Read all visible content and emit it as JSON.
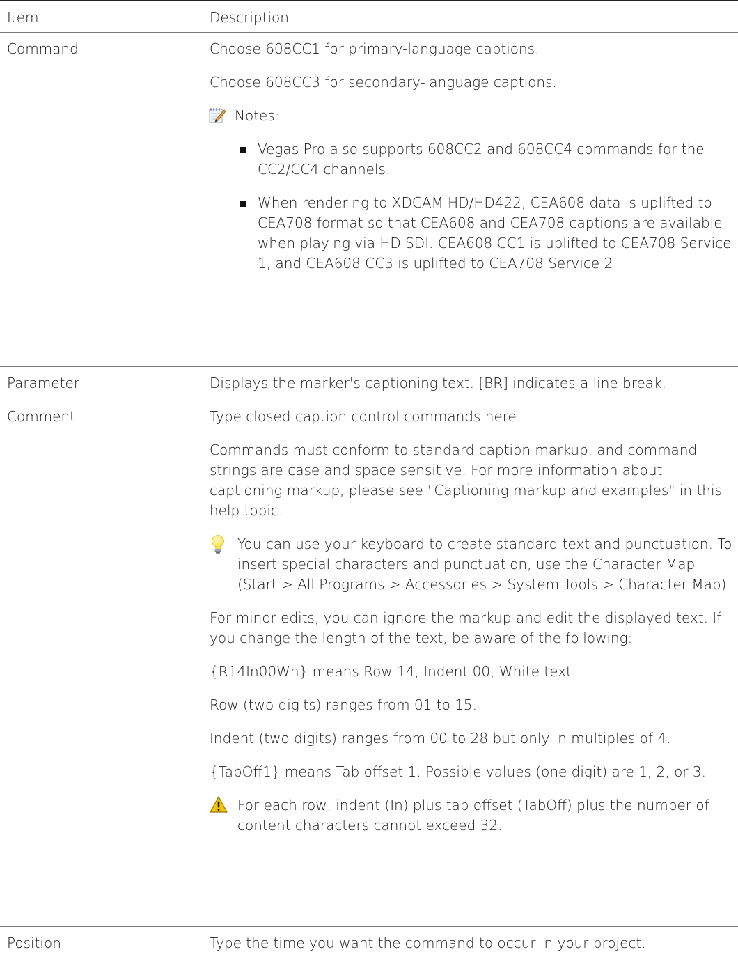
{
  "header": {
    "item": "Item",
    "description": "Description"
  },
  "rows": {
    "command": {
      "item": "Command",
      "p1": "Choose 608CC1 for primary-language captions.",
      "p2": "Choose 608CC3 for secondary-language captions.",
      "notes_label": "Notes:",
      "bullet1": "Vegas Pro also supports 608CC2 and 608CC4 commands for the CC2/CC4 channels.",
      "bullet2": "When rendering to XDCAM HD/HD422, CEA608 data is uplifted to CEA708 format so that CEA608 and CEA708 captions are available when playing via HD SDI. CEA608 CC1 is uplifted to CEA708 Service 1, and CEA608 CC3 is uplifted to CEA708 Service 2."
    },
    "parameter": {
      "item": "Parameter",
      "desc": "Displays the marker's captioning text. [BR] indicates a line break."
    },
    "comment": {
      "item": "Comment",
      "p1": "Type closed caption control commands here.",
      "p2": "Commands must conform to standard caption markup, and command strings are case and space sensitive. For more information about captioning markup, please see \"Captioning markup and examples\" in this help topic.",
      "tip": "You can use your keyboard to create standard text and punctuation. To insert special characters and punctuation, use the Character Map (Start > All Programs > Accessories > System Tools > Character Map)",
      "p3": "For minor edits, you can ignore the markup and edit the displayed text. If you change the length of the text, be aware of the following:",
      "p4": "{R14In00Wh} means Row 14, Indent 00, White text.",
      "p5": "Row (two digits) ranges from 01 to 15.",
      "p6": "Indent (two digits) ranges from 00 to 28 but only in multiples of 4.",
      "p7": "{TabOff1} means Tab offset 1. Possible values (one digit) are 1, 2, or 3.",
      "warning": "For each row, indent (In) plus tab offset (TabOff) plus the number of content characters cannot exceed 32."
    },
    "position": {
      "item": "Position",
      "desc": "Type the time you want the command to occur in your project."
    }
  },
  "icons": {
    "note": "notepad-pencil-icon",
    "tip": "lightbulb-icon",
    "warning": "warning-triangle-icon"
  },
  "colors": {
    "tip_bulb": "#f2de4a",
    "warning_fill": "#f5c400",
    "text": "#1a1a1a"
  }
}
